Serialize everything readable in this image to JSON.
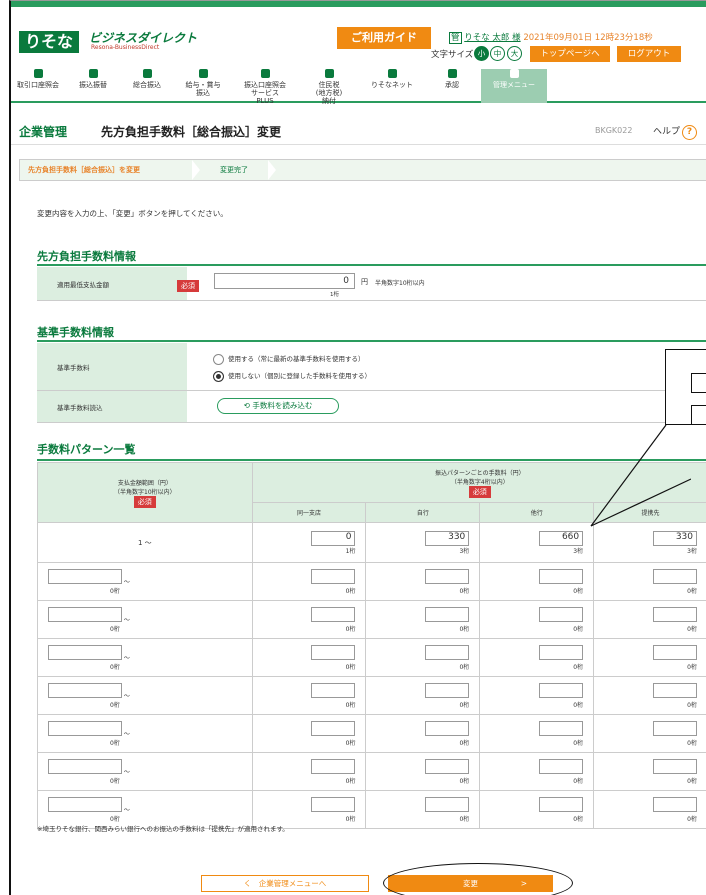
{
  "header": {
    "logo": "りそな",
    "brand": "ビジネスダイレクト",
    "brand_sub": "Resona-BusinessDirect",
    "guide_btn": "ご利用ガイド",
    "user_name": "りそな 太郎 様",
    "datetime": "2021年09月01日 12時23分18秒",
    "font_size_label": "文字サイズ",
    "fs_small": "小",
    "fs_mid": "中",
    "fs_large": "大",
    "top_btn": "トップページへ",
    "logout_btn": "ログアウト",
    "kanri_badge": "管"
  },
  "menu": [
    {
      "label": "取引口座照会"
    },
    {
      "label": "振込振替"
    },
    {
      "label": "総合振込"
    },
    {
      "label": "給与・賞与\n振込"
    },
    {
      "label": "振込口座照会\nサービス\nPLUS"
    },
    {
      "label": "住民税\n(地方税)\n納付"
    },
    {
      "label": "りそなネット"
    },
    {
      "label": "承認"
    },
    {
      "label": "管理メニュー"
    }
  ],
  "page": {
    "section": "企業管理",
    "title": "先方負担手数料［総合振込］変更",
    "screen_id": "BKGK022",
    "help": "ヘルプ",
    "help_icon": "?"
  },
  "steps": {
    "step1": "先方負担手数料［総合振込］を変更",
    "step2": "変更完了"
  },
  "instruction": "変更内容を入力の上、「変更」ボタンを押してください。",
  "fee_info": {
    "heading": "先方負担手数料情報",
    "label": "適用最低支払金額",
    "required": "必須",
    "value": "0",
    "unit": "円",
    "hint": "半角数字10桁以内",
    "digits": "1桁"
  },
  "base_fee": {
    "heading": "基準手数料情報",
    "label": "基準手数料",
    "opt1": "使用する（常に最新の基準手数料を使用する）",
    "opt2": "使用しない（個別に登録した手数料を使用する）",
    "load_label": "基準手数料読込",
    "load_btn": "手数料を読み込む"
  },
  "pattern": {
    "heading": "手数料パターン一覧",
    "range_header": "支払金額範囲（円）\n（半角数字10桁以内）",
    "range_req": "必須",
    "fee_header": "振込パターンごとの手数料（円）\n（半角数字4桁以内）",
    "fee_req": "必須",
    "cols": [
      "同一支店",
      "自行",
      "他行",
      "提携先"
    ],
    "row1": {
      "range": "1 ～",
      "fees": [
        "0",
        "330",
        "660",
        "330"
      ],
      "digits": [
        "1桁",
        "3桁",
        "3桁",
        "3桁"
      ]
    },
    "empty_digits": "0桁",
    "tilde": "～"
  },
  "note": "※埼玉りそな銀行、関西みらい銀行へのお振込の手数料は「提携先」が適用されます。",
  "buttons": {
    "back": "く　企業管理メニューへ",
    "submit": "変更"
  }
}
